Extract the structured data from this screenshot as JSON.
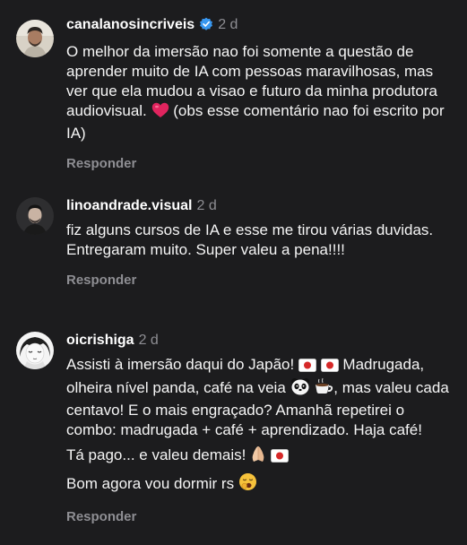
{
  "comments": [
    {
      "username": "canalanosincriveis",
      "verified": true,
      "time": "2 d",
      "lines": [
        "O melhor da imersão nao foi somente a questão de aprender muito de IA com pessoas maravilhosas, mas ver que ela mudou a visao e futuro da minha produtora audiovisual.",
        "(obs esse comentário nao foi escrito por IA)"
      ],
      "reply_label": "Responder"
    },
    {
      "username": "linoandrade.visual",
      "verified": false,
      "time": "2 d",
      "lines": [
        "fiz alguns cursos de IA e esse me tirou várias duvidas. Entregaram muito. Super valeu a pena!!!!"
      ],
      "reply_label": "Responder"
    },
    {
      "username": "oicrishiga",
      "verified": false,
      "time": "2 d",
      "lines": [
        "Assisti à imersão daqui do Japão!",
        "Madrugada, olheira nível panda, café na veia",
        ", mas valeu cada centavo! E o mais engraçado? Amanhã repetirei o combo: madrugada + café + aprendizado. Haja café!",
        "Tá pago... e valeu demais!",
        "Bom agora vou dormir rs"
      ],
      "reply_label": "Responder"
    }
  ],
  "colors": {
    "background": "#1c1c1e",
    "text": "#f5f5f5",
    "muted": "#8e8e93",
    "verified_badge": "#3897f0",
    "heart": "#e0245e"
  },
  "icons": [
    "verified-badge-icon",
    "heart-icon",
    "japan-flag-icon",
    "panda-icon",
    "coffee-icon",
    "folded-hands-icon",
    "yawning-face-icon"
  ]
}
